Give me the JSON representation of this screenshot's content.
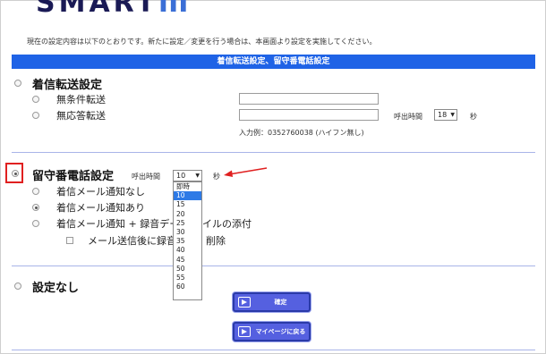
{
  "logo": {
    "text": "SMART",
    "suffix": "III"
  },
  "notice": "現在の設定内容は以下のとおりです。新たに設定／変更を行う場合は、本画面より設定を実施してください。",
  "banner": "着信転送設定、留守番電話設定",
  "forwarding": {
    "title": "着信転送設定",
    "unconditional_label": "無条件転送",
    "unconditional_value": "",
    "no_answer_label": "無応答転送",
    "no_answer_value": "",
    "ring_time_label": "呼出時間",
    "ring_time_value": "18",
    "seconds_label": "秒",
    "example": "入力例：0352760038 (ハイフン無し)"
  },
  "voicemail": {
    "title": "留守番電話設定",
    "ring_time_label": "呼出時間",
    "ring_time_value": "10",
    "seconds_label": "秒",
    "option_no_notify": "着信メール通知なし",
    "option_notify": "着信メール通知あり",
    "option_notify_attach_a": "着信メール通知 + 録音デー",
    "option_notify_attach_b": "イルの添付",
    "delete_after_send_a": "メール送信後に録音",
    "delete_after_send_b": "削除",
    "dropdown_options": [
      "即時",
      "10",
      "15",
      "20",
      "25",
      "30",
      "35",
      "40",
      "45",
      "50",
      "55",
      "60"
    ]
  },
  "no_setting": {
    "title": "設定なし"
  },
  "buttons": {
    "confirm": "確定",
    "back": "マイページに戻る"
  },
  "colors": {
    "banner": "#1f63e6",
    "highlight": "#e02020",
    "button": "#5560e0"
  }
}
